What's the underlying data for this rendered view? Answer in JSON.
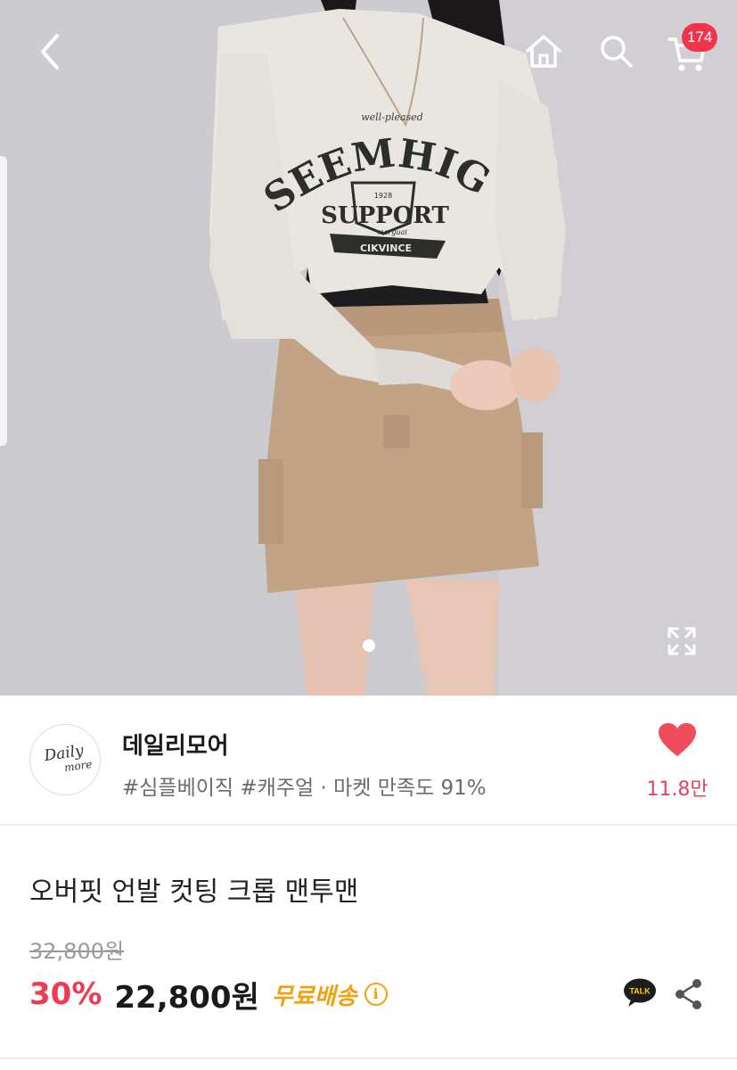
{
  "header": {
    "back_icon": "chevron-left-icon",
    "home_icon": "home-icon",
    "search_icon": "search-icon",
    "cart_icon": "cart-icon",
    "cart_count": "174",
    "badge_color": "#f0344c"
  },
  "photo": {
    "print_small_top": "well-pleased",
    "print_arc": "SEEMHIGHLY",
    "print_year": "1928",
    "print_main": "SUPPORT",
    "print_sub": "marguai",
    "print_banner": "CIKVINCE",
    "expand_icon": "expand-icon"
  },
  "shop": {
    "logo_top": "Daily",
    "logo_bottom": "more",
    "name": "데일리모어",
    "tags": "#심플베이직 #캐주얼 · 마켓 만족도 91%",
    "like_count": "11.8만",
    "accent": "#e0475a"
  },
  "product": {
    "title": "오버핏 언발 컷팅 크롭 맨투맨",
    "original_price": "32,800원",
    "discount": "30%",
    "price": "22,800원",
    "shipping": "무료배송",
    "info_symbol": "i",
    "talk_label": "TALK",
    "discount_color": "#ef3a52",
    "shipping_color": "#f0a20c"
  }
}
